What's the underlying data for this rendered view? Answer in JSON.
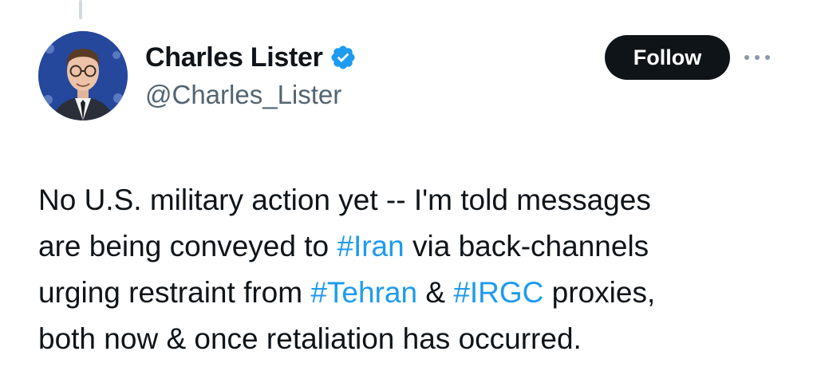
{
  "author": {
    "display_name": "Charles Lister",
    "handle": "@Charles_Lister",
    "verified": true,
    "verified_icon": "verified-badge-icon",
    "avatar_icon": "profile-photo"
  },
  "actions": {
    "follow_label": "Follow",
    "more_icon": "more-options-icon"
  },
  "tweet": {
    "lines": [
      {
        "segments": [
          {
            "text": "No U.S. military action yet -- I'm told messages"
          }
        ]
      },
      {
        "segments": [
          {
            "text": "are being conveyed to "
          },
          {
            "text": "#Iran",
            "hashtag": true
          },
          {
            "text": " via back-channels"
          }
        ]
      },
      {
        "segments": [
          {
            "text": "urging restraint from "
          },
          {
            "text": "#Tehran",
            "hashtag": true
          },
          {
            "text": " & "
          },
          {
            "text": "#IRGC",
            "hashtag": true
          },
          {
            "text": " proxies,"
          }
        ]
      },
      {
        "segments": [
          {
            "text": "both now & once retaliation has occurred."
          }
        ]
      }
    ]
  },
  "colors": {
    "text_primary": "#0f1419",
    "text_secondary": "#536471",
    "hashtag": "#1d9bf0",
    "verified": "#1d9bf0",
    "follow_bg": "#0f1419",
    "follow_text": "#ffffff"
  }
}
